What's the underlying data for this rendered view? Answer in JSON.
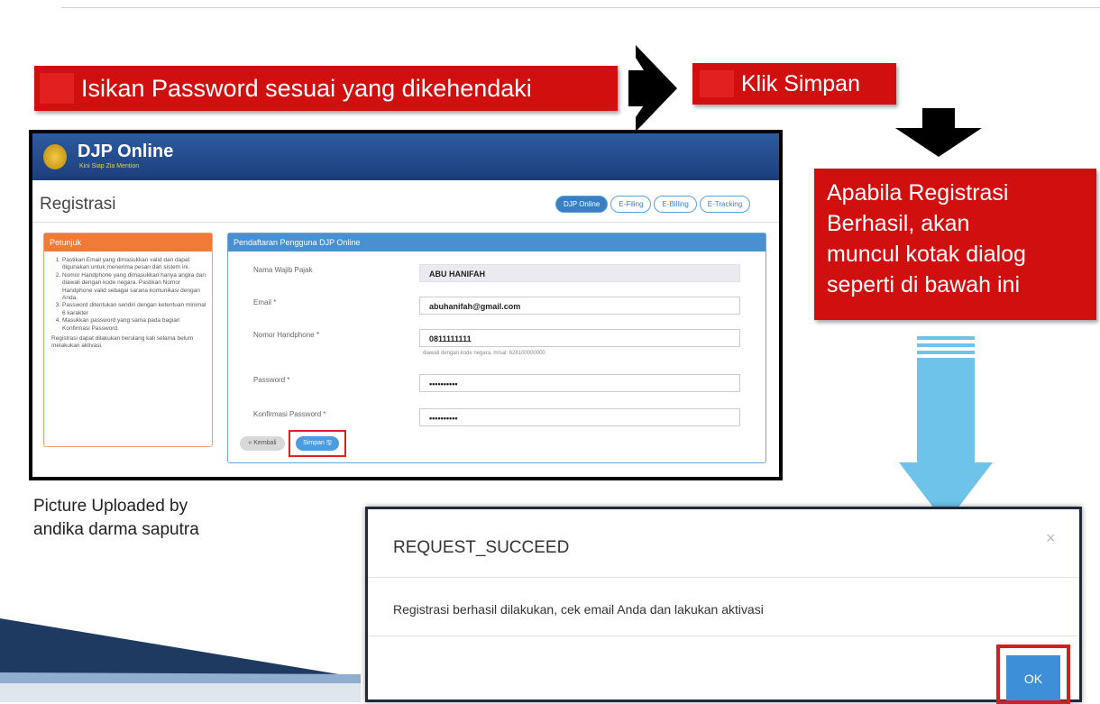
{
  "banners": {
    "isikan": "Isikan Password sesuai yang dikehendaki",
    "klik": "Klik Simpan",
    "apabila": "Apabila Registrasi\nBerhasil, akan\nmuncul kotak dialog\nseperti di bawah ini"
  },
  "djp": {
    "title": "DJP Online",
    "subtitle": "Kini Siap Zia Mention",
    "page_title": "Registrasi",
    "steps": [
      "DJP Online",
      "E-Filing",
      "E-Billing",
      "E-Tracking"
    ],
    "petunjuk": {
      "heading": "Petunjuk",
      "items": [
        "Pastikan Email yang dimasukkan valid dan dapat digunakan untuk menerima pesan dari sistem ini.",
        "Nomor Handphone yang dimasukkan hanya angka dan diawali dengan kode negara. Pastikan Nomor Handphone valid sebagai sarana komunikasi dengan Anda.",
        "Password ditentukan sendiri dengan ketentuan minimal 6 karakter",
        "Masukkan password yang sama pada bagian Konfirmasi Password."
      ],
      "note": "Registrasi dapat dilakukan berulang kali selama belum melakukan aktivasi."
    },
    "form": {
      "heading": "Pendaftaran Pengguna DJP Online",
      "nama_label": "Nama Wajib Pajak",
      "nama_value": "ABU HANIFAH",
      "email_label": "Email *",
      "email_value": "abuhanifah@gmail.com",
      "hp_label": "Nomor Handphone *",
      "hp_value": "0811111111",
      "hp_hint": "diawali dengan kode negara, misal: 628100000000",
      "pass_label": "Password *",
      "pass_value": "••••••••••",
      "konf_label": "Konfirmasi Password *",
      "konf_value": "••••••••••",
      "kembali": "« Kembali",
      "simpan": "Simpan 🖫"
    }
  },
  "caption": "Picture Uploaded by\nandika darma saputra",
  "dialog": {
    "title": "REQUEST_SUCCEED",
    "close": "×",
    "message": "Registrasi berhasil dilakukan, cek email Anda dan lakukan aktivasi",
    "ok": "OK"
  },
  "colors": {
    "banner_red": "#d10f0f",
    "djp_blue": "#1c3f7a",
    "petunjuk_orange": "#f07a38",
    "form_blue": "#4a8fcf",
    "down_arrow": "#6ec3ea",
    "highlight_red": "#e02020"
  }
}
